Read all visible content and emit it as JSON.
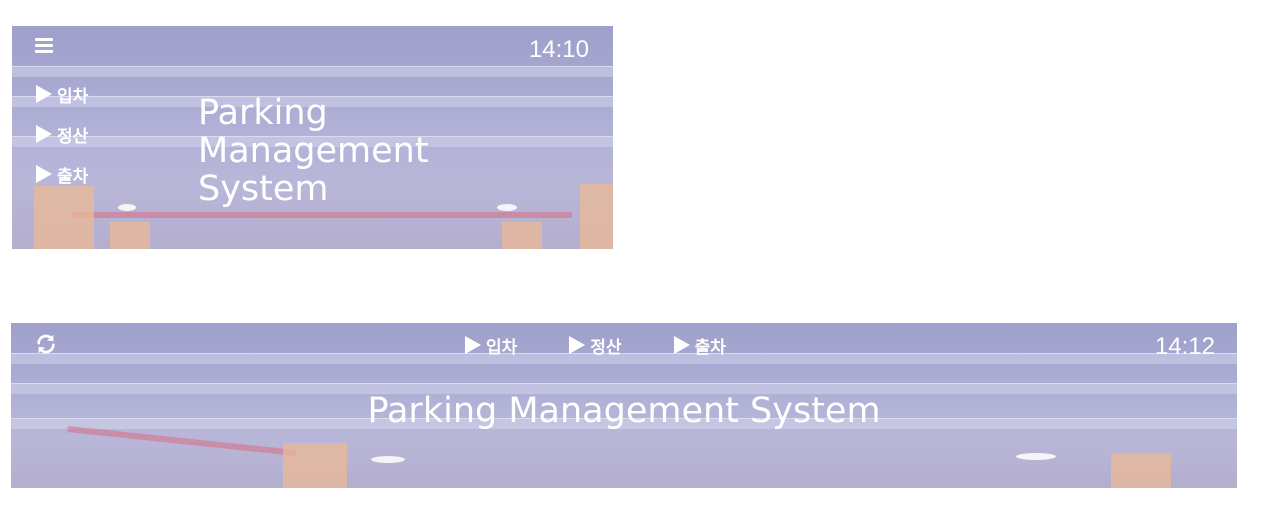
{
  "compact_view": {
    "menu_icon": "hamburger-icon",
    "clock": "14:10",
    "nav": [
      {
        "label": "입차"
      },
      {
        "label": "정산"
      },
      {
        "label": "출차"
      }
    ],
    "title_lines": [
      "Parking",
      "Management",
      "System"
    ]
  },
  "wide_view": {
    "refresh_icon": "refresh-icon",
    "clock": "14:12",
    "nav": [
      {
        "label": "입차"
      },
      {
        "label": "정산"
      },
      {
        "label": "출차"
      }
    ],
    "title": "Parking Management System"
  },
  "colors": {
    "overlay": "#a9a9cf",
    "text": "#ffffff",
    "pillar": "#ebb996"
  }
}
